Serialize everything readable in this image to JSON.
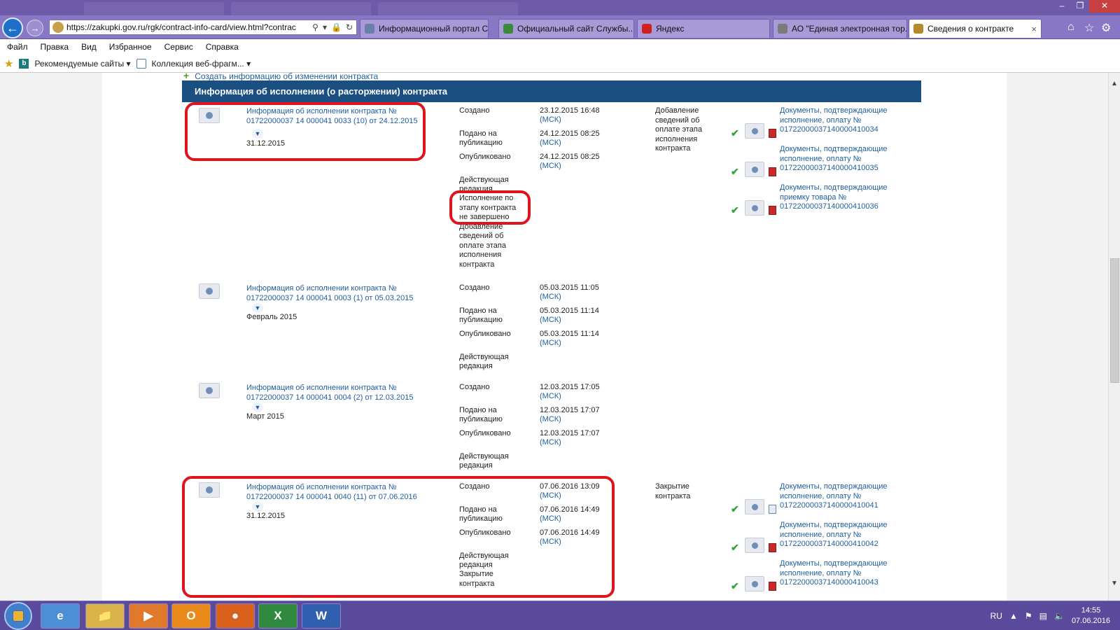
{
  "browser": {
    "address": "https://zakupki.gov.ru/rgk/contract-info-card/view.html?contrac",
    "tabs": [
      {
        "label": "Информационный портал С...",
        "color": "#6b7fa8"
      },
      {
        "label": "Официальный сайт Службы...",
        "color": "#3b8a3b"
      },
      {
        "label": "Яндекс",
        "color": "#d02020"
      },
      {
        "label": "АО \"Единая электронная тор...",
        "color": "#7a7a7a"
      },
      {
        "label": "Сведения о контракте",
        "color": "#b58a2a",
        "active": true
      }
    ],
    "tab_close": "×"
  },
  "menu": [
    "Файл",
    "Правка",
    "Вид",
    "Избранное",
    "Сервис",
    "Справка"
  ],
  "favorites": {
    "recommended": "Рекомендуемые сайты",
    "collection": "Коллекция веб-фрагм..."
  },
  "page": {
    "create_link": "Создать информацию об изменении контракта",
    "section_title": "Информация об исполнении (о расторжении) контракта",
    "labels": {
      "created": "Создано",
      "submitted": "Подано на публикацию",
      "published": "Опубликовано",
      "current": "Действующая редакция",
      "msk": "(МСК)"
    },
    "entries": [
      {
        "title": "Информация об исполнении контракта № 01722000037 14 000041 0033 (10) от 24.12.2015",
        "period": "31.12.2015",
        "created": "23.12.2015 16:48",
        "submitted": "24.12.2015 08:25",
        "published": "24.12.2015 08:25",
        "status_extra": "Исполнение по этапу контракта не завершено",
        "status_extra2": "Добавление сведений об оплате этапа исполнения контракта",
        "event": "Добавление сведений об оплате этапа исполнения контракта",
        "docs": [
          {
            "label": "Документы, подтверждающие исполнение, оплату № 0172200003714000041003​4"
          },
          {
            "label": "Документы, подтверждающие исполнение, оплату № 01722000037140000410035"
          },
          {
            "label": "Документы, подтверждающие приемку товара № 01722000037140000410036"
          }
        ]
      },
      {
        "title": "Информация об исполнении контракта № 01722000037 14 000041 0003 (1) от 05.03.2015",
        "period": "Февраль 2015",
        "created": "05.03.2015 11:05",
        "submitted": "05.03.2015 11:14",
        "published": "05.03.2015 11:14"
      },
      {
        "title": "Информация об исполнении контракта № 01722000037 14 000041 0004 (2) от 12.03.2015",
        "period": "Март 2015",
        "created": "12.03.2015 17:05",
        "submitted": "12.03.2015 17:07",
        "published": "12.03.2015 17:07"
      },
      {
        "title": "Информация об исполнении контракта № 01722000037 14 000041 0040 (11) от 07.06.2016",
        "period": "31.12.2015",
        "created": "07.06.2016 13:09",
        "submitted": "07.06.2016 14:49",
        "published": "07.06.2016 14:49",
        "status_extra": "Закрытие контракта",
        "event": "Закрытие контракта",
        "docs": [
          {
            "label": "Документы, подтверждающие исполнение, оплату № 01722000037140000410041"
          },
          {
            "label": "Документы, подтверждающие исполнение, оплату № 01722000037140000410042"
          },
          {
            "label": "Документы, подтверждающие исполнение, оплату № 01722000037140000410043"
          }
        ]
      }
    ]
  },
  "taskbar": {
    "lang": "RU",
    "time": "14:55",
    "date": "07.06.2016"
  },
  "colors": {
    "header": "#1b4f82",
    "link": "#1f5e9e",
    "highlight": "#e0141e"
  }
}
